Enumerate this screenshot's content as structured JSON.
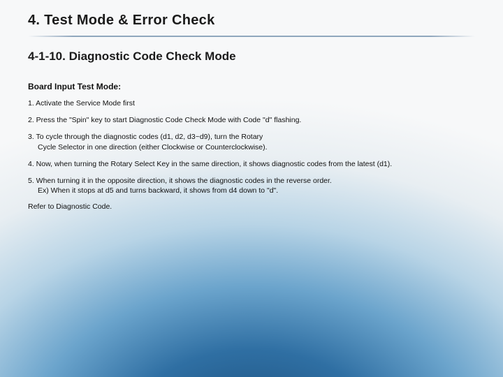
{
  "chapter_title": "4. Test Mode & Error Check",
  "section_title": "4-1-10.  Diagnostic Code Check Mode",
  "subhead": "Board Input Test Mode:",
  "steps": {
    "s1": "1. Activate the Service Mode first",
    "s2": "2. Press the \"Spin\" key to start Diagnostic Code Check Mode with Code \"d\" flashing.",
    "s3a": "3. To cycle through the diagnostic codes (d1, d2, d3~d9), turn the Rotary",
    "s3b": "Cycle Selector in one direction (either Clockwise or Counterclockwise).",
    "s4": "4. Now, when turning the Rotary Select Key in the same direction,  it shows diagnostic codes from the latest (d1).",
    "s5a": "5. When turning it in the opposite direction, it shows the diagnostic codes in the reverse order.",
    "s5b": "Ex) When it stops at d5 and turns backward, it shows from d4 down to \"d\"."
  },
  "refer": "Refer to Diagnostic Code."
}
